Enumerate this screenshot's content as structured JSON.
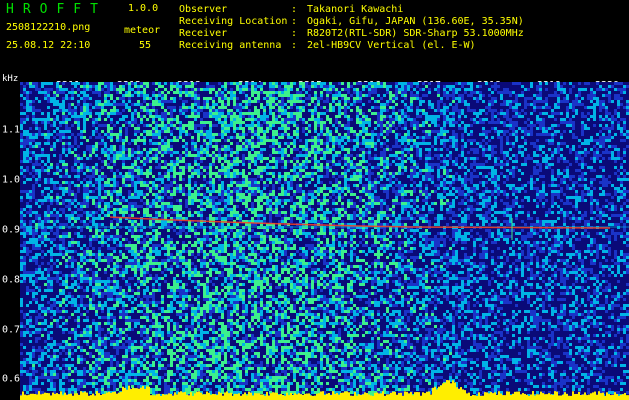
{
  "header": {
    "app_title": "HROFFT",
    "version": "1.0.0",
    "filename": "2508122210.png",
    "mode": "meteor",
    "datetime": "25.08.12 22:10",
    "count": "55",
    "observer_label": "Observer",
    "observer_value": "Takanori Kawachi",
    "location_label": "Receiving Location",
    "location_value": "Ogaki, Gifu, JAPAN (136.60E, 35.35N)",
    "receiver_label": "Receiver",
    "receiver_value": "R820T2(RTL-SDR) SDR-Sharp 53.1000MHz",
    "antenna_label": "Receiving antenna",
    "antenna_value": "2el-HB9CV Vertical (el. E-W)",
    "separator": ":"
  },
  "axes": {
    "unit_label": "kHz",
    "time_labels": [
      "2211",
      "2212",
      "2213",
      "2214",
      "2215",
      "2216",
      "2217",
      "2218",
      "2219",
      "2220"
    ],
    "freq_labels": [
      "1.1",
      "1.0",
      "0.9",
      "0.8",
      "0.7",
      "0.6"
    ]
  },
  "colors": {
    "background": "#0a0a78",
    "noise_low": "#1a33c8",
    "noise_mid": "#00b4e6",
    "noise_high": "#3cf08c",
    "trace": "#ff4020",
    "power_bar": "#ffee00",
    "title_green": "#00e000",
    "text_yellow": "#ffff00"
  },
  "features": {
    "carrier_freq_khz": 0.9,
    "meteor_trail": "reddish streak near 0.9 kHz from 2212 to 2216",
    "bottom_band": "yellow signal power strip"
  }
}
